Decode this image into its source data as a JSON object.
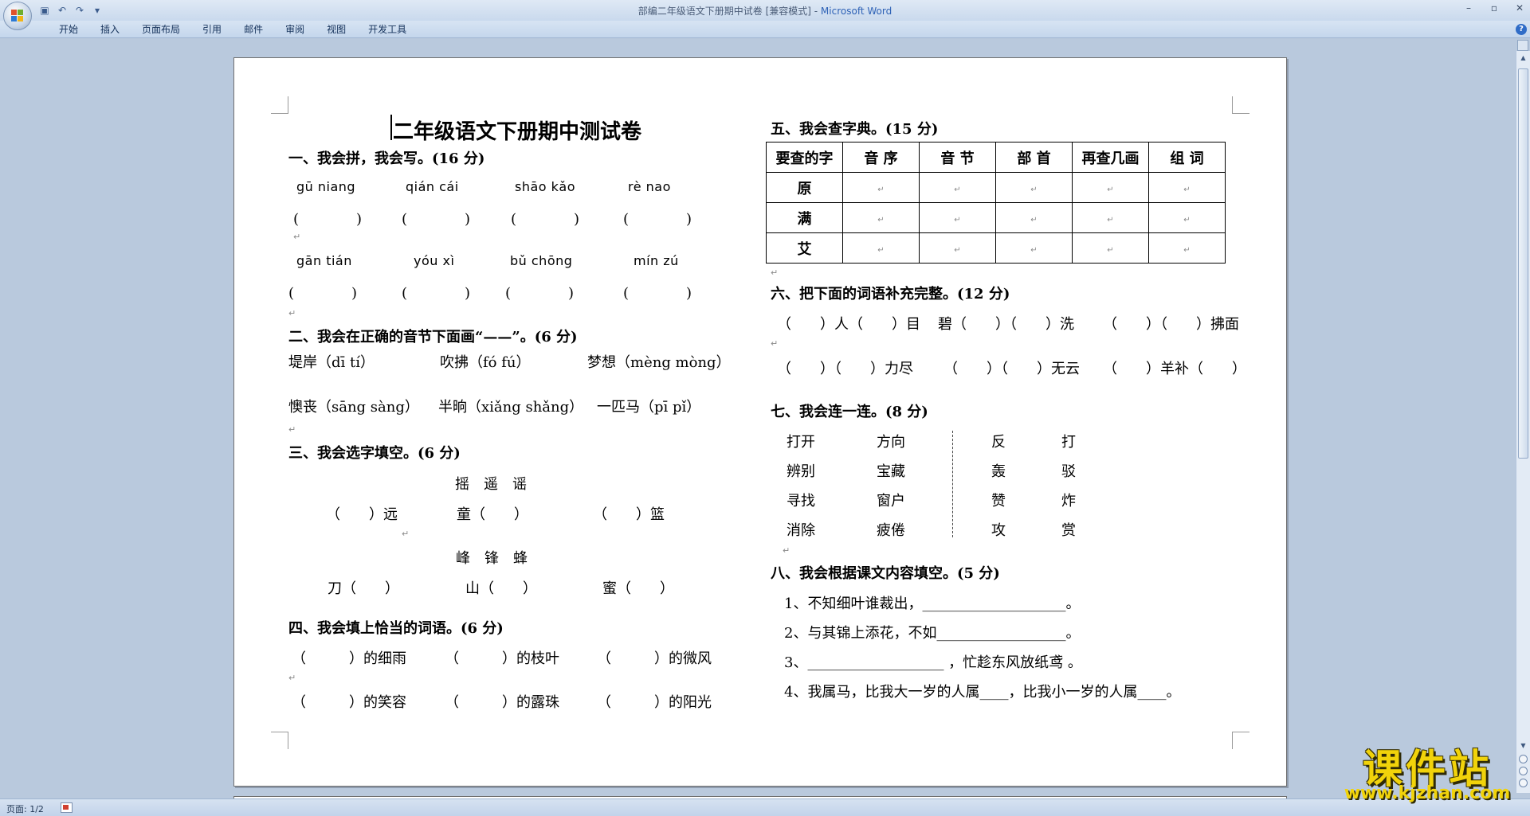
{
  "window": {
    "title": "部编二年级语文下册期中试卷 [兼容模式] - ",
    "brand": "Microsoft Word"
  },
  "quick_access": [
    "save-icon",
    "undo-icon",
    "redo-icon",
    "customize-icon"
  ],
  "ribbon": {
    "tabs": [
      "开始",
      "插入",
      "页面布局",
      "引用",
      "邮件",
      "审阅",
      "视图",
      "开发工具"
    ]
  },
  "status": {
    "page": "页面: 1/2"
  },
  "doc": {
    "title": "二年级语文下册期中测试卷",
    "s1": {
      "heading": "一、我会拼，我会写。(16 分)",
      "row1": [
        "gū  niang",
        "qián  cái",
        "shāo  kǎo",
        "rè  nao"
      ],
      "row2": [
        "gān  tián",
        "yóu  xì",
        "bǔ  chōng",
        "mín  zú"
      ],
      "bracket": "(　　　　)"
    },
    "s2": {
      "heading": "二、我会在正确的音节下面画“——”。(6 分)",
      "items": [
        "堤岸（dī  tí）",
        "吹拂（fó  fú）",
        "梦想（mèng mòng）",
        "懊丧（sāng  sàng）",
        "半晌（xiǎng  shǎng）",
        "一匹马（pī  pǐ）"
      ]
    },
    "s3": {
      "heading": "三、我会选字填空。(6 分)",
      "chars1": "摇　遥　谣",
      "blanks1": [
        "（　　）远",
        "童（　　）",
        "（　　）篮"
      ],
      "chars2": "峰　锋　蜂",
      "blanks2": [
        "刀（　　）",
        "山（　　）",
        "蜜（　　）"
      ]
    },
    "s4": {
      "heading": "四、我会填上恰当的词语。(6 分)",
      "row1": [
        "（　　　）的细雨",
        "（　　　）的枝叶",
        "（　　　）的微风"
      ],
      "row2": [
        "（　　　）的笑容",
        "（　　　）的露珠",
        "（　　　）的阳光"
      ]
    },
    "s5": {
      "heading": "五、我会查字典。(15 分)",
      "headers": [
        "要查的字",
        "音 序",
        "音 节",
        "部 首",
        "再查几画",
        "组 词"
      ],
      "rows": [
        "原",
        "满",
        "艾"
      ]
    },
    "s6": {
      "heading": "六、把下面的词语补充完整。(12 分)",
      "row1": [
        "（　　）人（　　）目",
        "碧（　　）（　　）洗",
        "（　　）（　　）拂面"
      ],
      "row2": [
        "（　　）（　　）力尽",
        "（　　）（　　）无云",
        "（　　）羊补（　　）"
      ]
    },
    "s7": {
      "heading": "七、我会连一连。(8 分)",
      "left_a": [
        "打开",
        "辨别",
        "寻找",
        "消除"
      ],
      "left_b": [
        "方向",
        "宝藏",
        "窗户",
        "疲倦"
      ],
      "right_a": [
        "反",
        "轰",
        "赞",
        "攻"
      ],
      "right_b": [
        "打",
        "驳",
        "炸",
        "赏"
      ]
    },
    "s8": {
      "heading": "八、我会根据课文内容填空。(5 分)",
      "lines": [
        "1、不知细叶谁裁出，____________________。",
        "2、与其锦上添花，不如__________________。",
        "3、___________________ ，忙趁东风放纸鸢 。",
        "4、我属马，比我大一岁的人属____，比我小一岁的人属____。"
      ]
    },
    "para_mark": "↵"
  },
  "watermark": {
    "text": "课件站",
    "url": "www.kjzhan.com"
  }
}
